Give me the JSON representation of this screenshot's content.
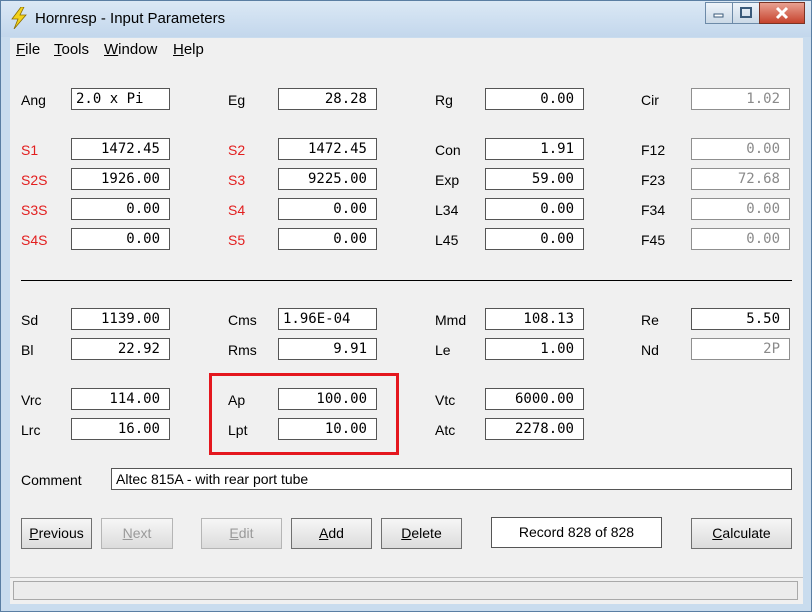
{
  "window": {
    "title": "Hornresp - Input Parameters"
  },
  "menu": [
    {
      "label": "File",
      "key": "F",
      "rest": "ile"
    },
    {
      "label": "Tools",
      "key": "T",
      "rest": "ools"
    },
    {
      "label": "Window",
      "key": "W",
      "rest": "indow"
    },
    {
      "label": "Help",
      "key": "H",
      "rest": "elp"
    }
  ],
  "fields": {
    "Ang": {
      "label": "Ang",
      "value": "2.0 x Pi"
    },
    "Eg": {
      "label": "Eg",
      "value": "28.28"
    },
    "Rg": {
      "label": "Rg",
      "value": "0.00"
    },
    "Cir": {
      "label": "Cir",
      "value": "1.02"
    },
    "S1": {
      "label": "S1",
      "value": "1472.45"
    },
    "S2": {
      "label": "S2",
      "value": "1472.45"
    },
    "Con": {
      "label": "Con",
      "value": "1.91"
    },
    "F12": {
      "label": "F12",
      "value": "0.00"
    },
    "S2S": {
      "label": "S2S",
      "value": "1926.00"
    },
    "S3": {
      "label": "S3",
      "value": "9225.00"
    },
    "Exp": {
      "label": "Exp",
      "value": "59.00"
    },
    "F23": {
      "label": "F23",
      "value": "72.68"
    },
    "S3S": {
      "label": "S3S",
      "value": "0.00"
    },
    "S4": {
      "label": "S4",
      "value": "0.00"
    },
    "L34": {
      "label": "L34",
      "value": "0.00"
    },
    "F34": {
      "label": "F34",
      "value": "0.00"
    },
    "S4S": {
      "label": "S4S",
      "value": "0.00"
    },
    "S5": {
      "label": "S5",
      "value": "0.00"
    },
    "L45": {
      "label": "L45",
      "value": "0.00"
    },
    "F45": {
      "label": "F45",
      "value": "0.00"
    },
    "Sd": {
      "label": "Sd",
      "value": "1139.00"
    },
    "Cms": {
      "label": "Cms",
      "value": "1.96E-04"
    },
    "Mmd": {
      "label": "Mmd",
      "value": "108.13"
    },
    "Re": {
      "label": "Re",
      "value": "5.50"
    },
    "Bl": {
      "label": "Bl",
      "value": "22.92"
    },
    "Rms": {
      "label": "Rms",
      "value": "9.91"
    },
    "Le": {
      "label": "Le",
      "value": "1.00"
    },
    "Nd": {
      "label": "Nd",
      "value": "2P"
    },
    "Vrc": {
      "label": "Vrc",
      "value": "114.00"
    },
    "Ap": {
      "label": "Ap",
      "value": "100.00"
    },
    "Vtc": {
      "label": "Vtc",
      "value": "6000.00"
    },
    "Lrc": {
      "label": "Lrc",
      "value": "16.00"
    },
    "Lpt": {
      "label": "Lpt",
      "value": "10.00"
    },
    "Atc": {
      "label": "Atc",
      "value": "2278.00"
    }
  },
  "comment": {
    "label": "Comment",
    "value": "Altec 815A - with rear port tube"
  },
  "buttons": {
    "previous": {
      "label": "Previous",
      "key": "P",
      "rest": "revious"
    },
    "next": {
      "label": "Next",
      "key": "N",
      "rest": "ext"
    },
    "edit": {
      "label": "Edit",
      "key": "E",
      "rest": "dit"
    },
    "add": {
      "label": "Add",
      "key": "A",
      "rest": "dd"
    },
    "delete": {
      "label": "Delete",
      "key": "D",
      "rest": "elete"
    },
    "calculate": {
      "label": "Calculate",
      "key": "C",
      "rest": "alculate"
    }
  },
  "record": "Record 828 of 828",
  "colors": {
    "red_label": "#e21e1e",
    "highlight": "#e4171e",
    "disabled_text": "#8a8a8a"
  }
}
